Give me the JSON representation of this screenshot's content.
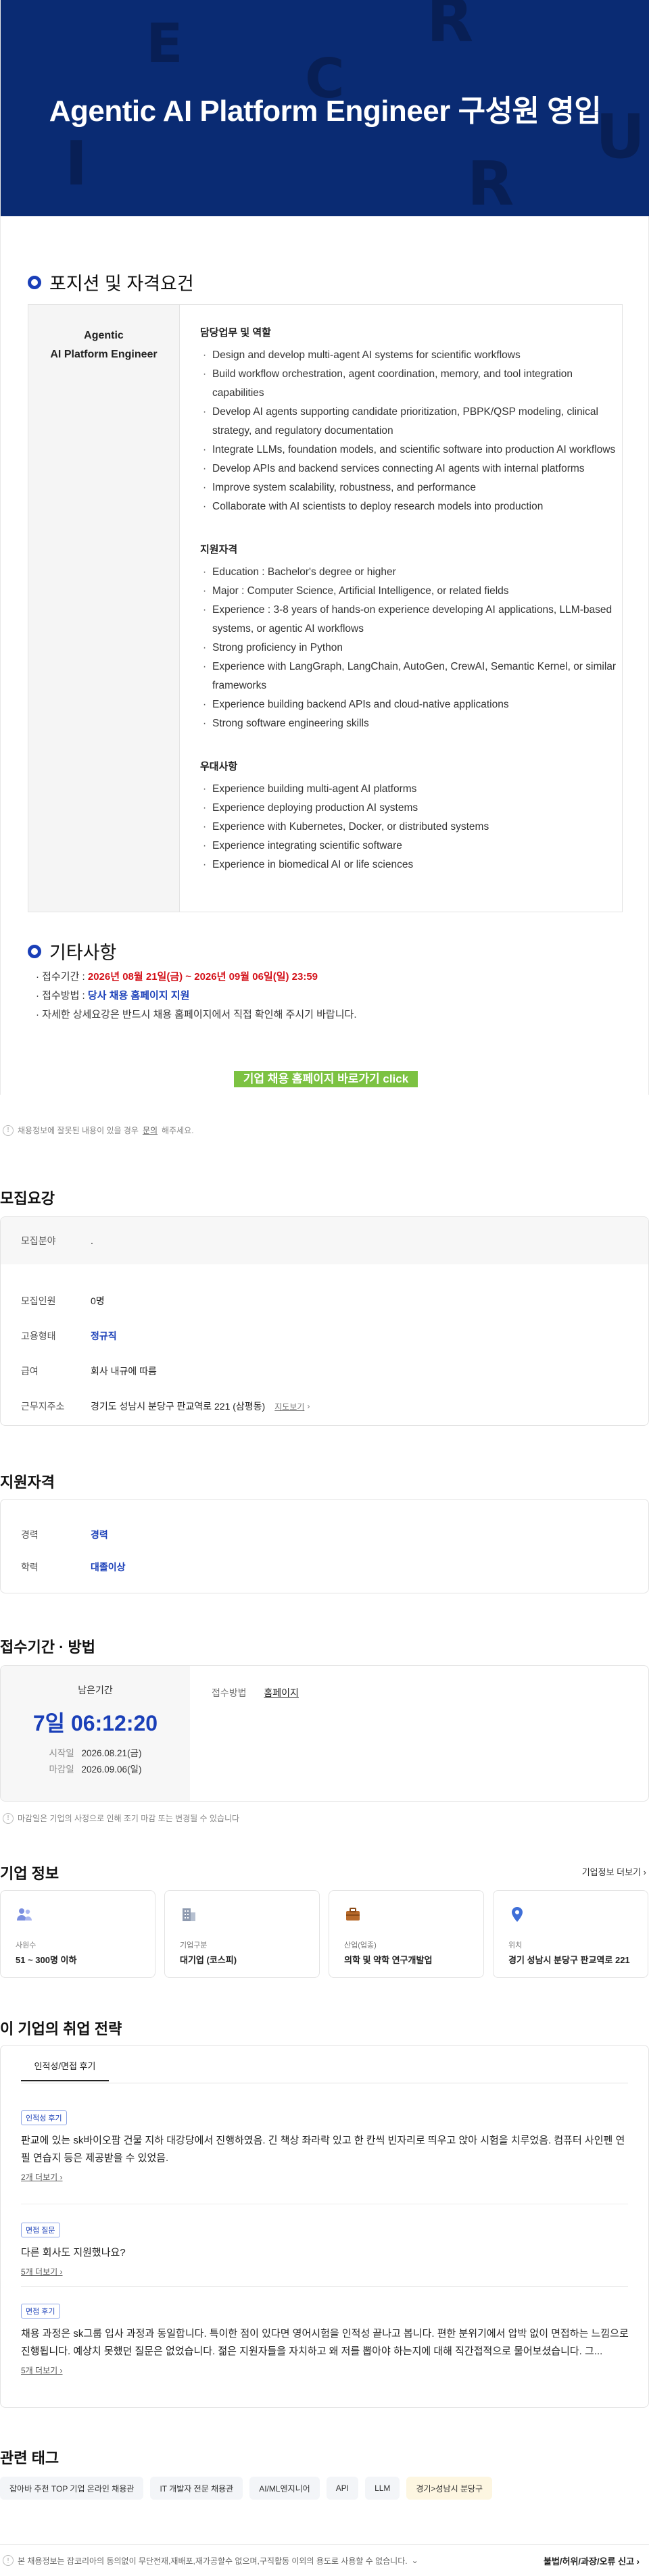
{
  "hero": {
    "title": "Agentic AI Platform Engineer 구성원 영입",
    "ghost_letters": [
      "E",
      "R",
      "C",
      "I",
      "R",
      "U"
    ]
  },
  "qualifications": {
    "heading": "포지션 및 자격요건",
    "position_line1": "Agentic",
    "position_line2": "AI Platform Engineer",
    "groups": [
      {
        "title": "담당업무 및 역할",
        "items": [
          "Design and develop multi-agent AI systems for scientific workflows",
          "Build workflow orchestration, agent coordination, memory, and tool integration capabilities",
          "Develop AI agents supporting candidate prioritization, PBPK/QSP modeling, clinical strategy, and regulatory documentation",
          "Integrate LLMs, foundation models, and scientific software into production AI workflows",
          "Develop APIs and backend services connecting AI agents with internal platforms",
          "Improve system scalability, robustness, and performance",
          "Collaborate with AI scientists to deploy research models into production"
        ]
      },
      {
        "title": "지원자격",
        "items": [
          "Education : Bachelor's degree or higher",
          "Major : Computer Science, Artificial Intelligence, or related fields",
          "Experience : 3-8 years of hands-on experience developing AI applications, LLM-based systems, or agentic AI workflows",
          "Strong proficiency in Python",
          "Experience with LangGraph, LangChain, AutoGen, CrewAI, Semantic Kernel, or similar frameworks",
          "Experience building backend APIs and cloud-native applications",
          "Strong software engineering skills"
        ]
      },
      {
        "title": "우대사항",
        "items": [
          "Experience building multi-agent AI platforms",
          "Experience deploying production AI systems",
          "Experience with Kubernetes, Docker, or distributed systems",
          "Experience integrating scientific software",
          "Experience in biomedical AI or life sciences"
        ]
      }
    ]
  },
  "etc": {
    "heading": "기타사항",
    "period_label": "접수기간 : ",
    "period_value": "2026년 08월 21일(금) ~ 2026년 09월 06일(일) 23:59",
    "method_label": "접수방법 : ",
    "method_value": "당사 채용 홈페이지 지원",
    "detail": "자세한 상세요강은 반드시 채용 홈페이지에서 직접 확인해 주시기 바랍니다.",
    "cta": "기업 채용 홈페이지 바로가기 click"
  },
  "notice1": {
    "text": "채용정보에 잘못된 내용이 있을 경우 ",
    "link": "문의",
    "suffix": "해주세요."
  },
  "recruit": {
    "heading": "모집요강",
    "field_label": "모집분야",
    "field_value": ".",
    "rows": [
      {
        "k": "모집인원",
        "v": "0명",
        "blue": false
      },
      {
        "k": "고용형태",
        "v": "정규직",
        "blue": true
      },
      {
        "k": "급여",
        "v": "회사 내규에 따름",
        "blue": false
      },
      {
        "k": "근무지주소",
        "v": "경기도 성남시 분당구 판교역로 221 (삼평동)",
        "blue": false
      }
    ],
    "map_link": "지도보기"
  },
  "eligibility": {
    "heading": "지원자격",
    "rows": [
      {
        "k": "경력",
        "v": "경력"
      },
      {
        "k": "학력",
        "v": "대졸이상"
      }
    ]
  },
  "apply": {
    "heading": "접수기간 · 방법",
    "remaining_label": "남은기간",
    "remaining": "7일 06:12:20",
    "start_label": "시작일",
    "start": "2026.08.21(금)",
    "end_label": "마감일",
    "end": "2026.09.06(일)",
    "method_label": "접수방법",
    "method_value": "홈페이지"
  },
  "notice2": {
    "text": "마감일은 기업의 사정으로 인해 조기 마감 또는 변경될 수 있습니다"
  },
  "company": {
    "heading": "기업 정보",
    "more": "기업정보 더보기",
    "cards": [
      {
        "icon": "people-icon",
        "label": "사원수",
        "value": "51 ~ 300명 이하"
      },
      {
        "icon": "building-icon",
        "label": "기업구분",
        "value": "대기업 (코스피)"
      },
      {
        "icon": "briefcase-icon",
        "label": "산업(업종)",
        "value": "의학 및 약학 연구개발업"
      },
      {
        "icon": "location-pin-icon",
        "label": "위치",
        "value": "경기 성남시 분당구 판교역로 221"
      }
    ]
  },
  "strategy": {
    "heading": "이 기업의 취업 전략",
    "tab": "인적성/면접 후기",
    "items": [
      {
        "badge": "인적성 후기",
        "body": "판교에 있는 sk바이오팜 건물 지하 대강당에서 진행하였음. 긴 책상 좌라락 있고 한 칸씩 빈자리로 띄우고 앉아 시험을 치루었음. 컴퓨터 사인펜 연필 연습지 등은 제공받을 수 있었음.",
        "more": "2개 더보기"
      },
      {
        "badge": "면접 질문",
        "body": "다른 회사도 지원했나요?",
        "more": "5개 더보기"
      },
      {
        "badge": "면접 후기",
        "body": "채용 과정은 sk그룹 입사 과정과 동일합니다. 특이한 점이 있다면 영어시험을 인적성 끝나고 봅니다. 편한 분위기에서 압박 없이 면접하는 느낌으로 진행됩니다. 예상치 못했던 질문은 없었습니다. 젊은 지원자들을 자치하고 왜 저를 뽑아야 하는지에 대해 직간접적으로 물어보셨습니다. 그...",
        "more": "5개 더보기"
      }
    ]
  },
  "tags": {
    "heading": "관련 태그",
    "items": [
      "잡아바 추천 TOP 기업 온라인 채용관",
      "IT 개발자 전문 채용관",
      "AI/ML엔지니어",
      "API",
      "LLM",
      "경기>성남시 분당구"
    ]
  },
  "footer": {
    "left": "본 채용정보는 잡코리아의 동의없이 무단전재,재배포,재가공할수 없으며,구직활동 이외의 용도로 사용할 수 없습니다.",
    "right": "불법/허위/과장/오류 신고"
  },
  "colors": {
    "brand_navy": "#0a2b73",
    "accent_blue": "#1a3fb8",
    "red": "#d4121a",
    "cta_green": "#7cc242"
  }
}
